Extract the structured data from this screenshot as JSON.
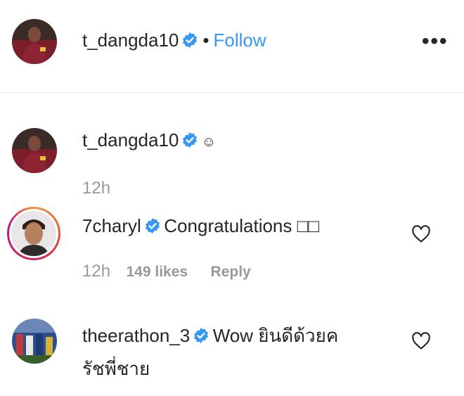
{
  "header": {
    "username": "t_dangda10",
    "separator": "•",
    "follow_label": "Follow",
    "more_label": "•••"
  },
  "comments": [
    {
      "username": "t_dangda10",
      "text": "☺",
      "time": "12h",
      "likes": "",
      "reply": ""
    },
    {
      "username": "7charyl",
      "text": "Congratulations □□",
      "time": "12h",
      "likes": "149 likes",
      "reply": "Reply"
    },
    {
      "username": "theerathon_3",
      "text_line1": "Wow ยินดีด้วยค",
      "text_line2": "รัชพี่ชาย"
    }
  ],
  "colors": {
    "link_blue": "#3897f0",
    "verified_blue": "#3897f0",
    "text": "#262626",
    "muted": "#999999"
  },
  "icons": [
    "verified-badge-icon",
    "more-options-icon",
    "heart-icon"
  ]
}
